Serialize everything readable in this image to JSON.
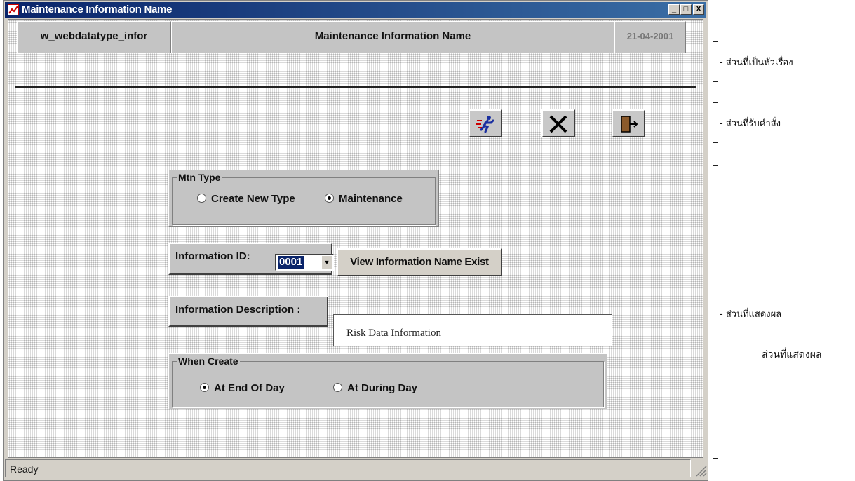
{
  "window": {
    "title": "Maintenance Information Name",
    "controls": {
      "minimize": "_",
      "maximize": "□",
      "close": "X"
    }
  },
  "header": {
    "form_id": "w_webdatatype_infor",
    "form_title": "Maintenance Information Name",
    "date": "21-04-2001"
  },
  "toolbar": {
    "buttons": [
      {
        "name": "run",
        "icon": "running-man-icon"
      },
      {
        "name": "cancel",
        "icon": "cross-icon"
      },
      {
        "name": "exit",
        "icon": "exit-door-icon"
      }
    ]
  },
  "mtn_type": {
    "label": "Mtn Type",
    "options": [
      {
        "label": "Create New Type",
        "selected": false
      },
      {
        "label": "Maintenance",
        "selected": true
      }
    ]
  },
  "information_id": {
    "label": "Information ID:",
    "value": "0001",
    "view_button": "View Information Name Exist"
  },
  "information_description": {
    "label": "Information Description :",
    "value": "Risk Data Information"
  },
  "when_create": {
    "label": "When Create",
    "options": [
      {
        "label": "At End Of Day",
        "selected": true
      },
      {
        "label": "At During Day",
        "selected": false
      }
    ]
  },
  "status_bar": {
    "text": "Ready"
  },
  "annotations": {
    "header_section": "- ส่วนที่เป็นหัวเรื่อง",
    "command_section": "- ส่วนที่รับคำสั่ง",
    "display_section": "- ส่วนที่แสดงผล",
    "display_caption": "ส่วนที่แสดงผล"
  },
  "colors": {
    "titlebar": "#0a246a",
    "window_face": "#d4d0c8",
    "selection": "#0a246a"
  }
}
